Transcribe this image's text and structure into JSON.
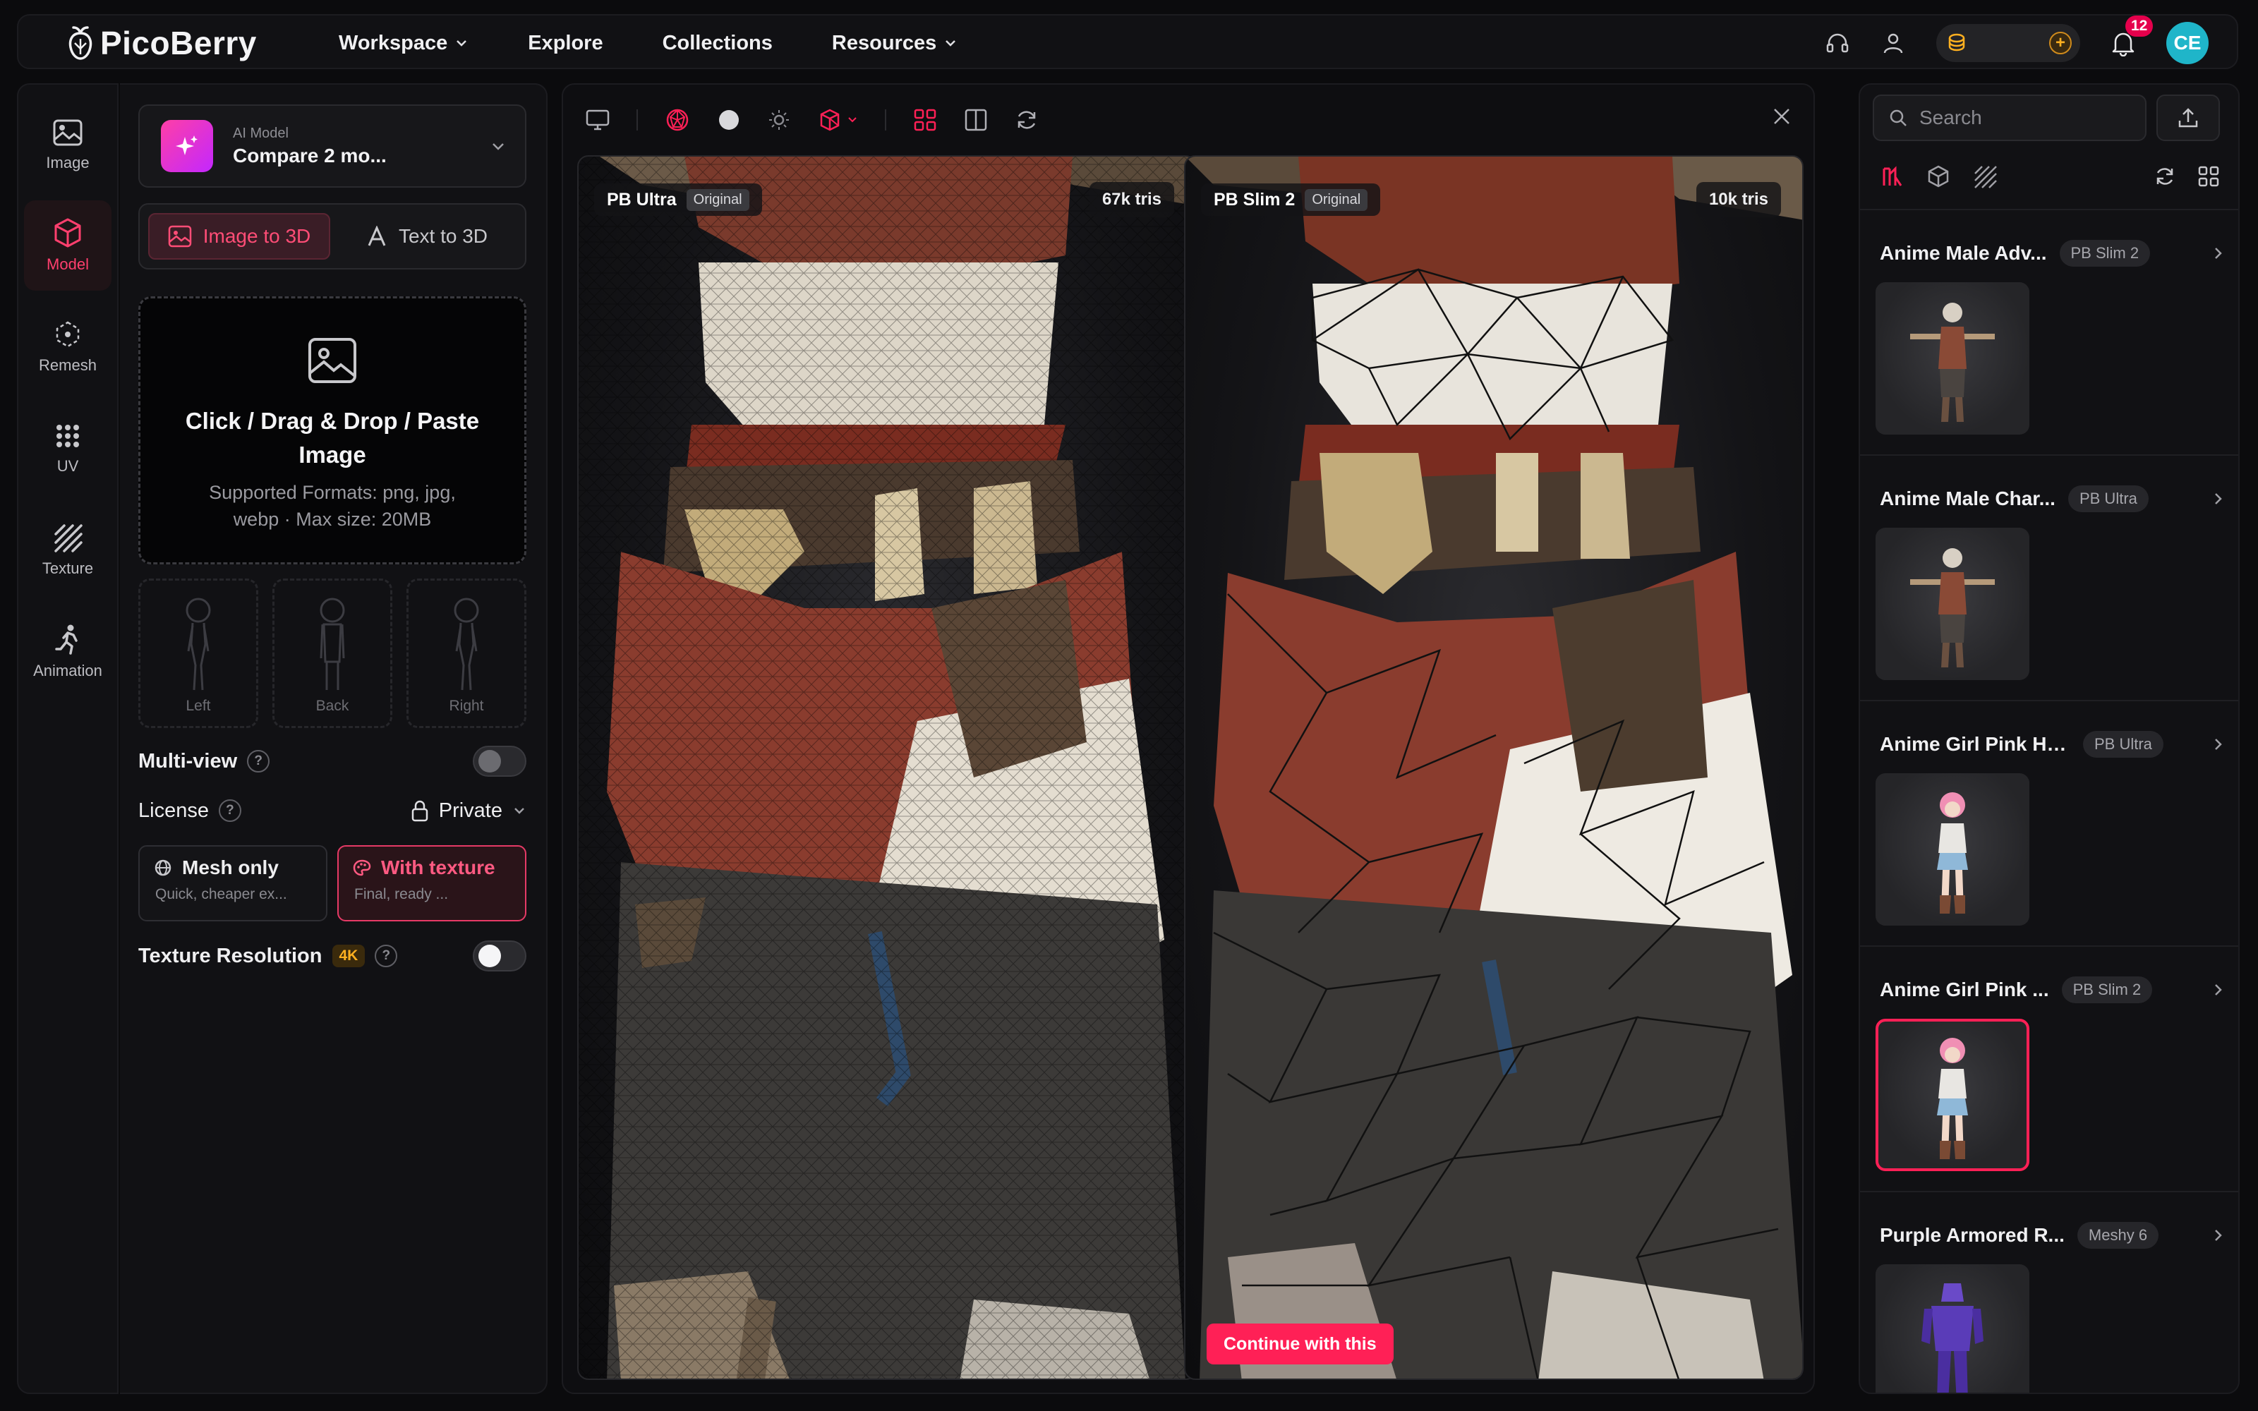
{
  "app": {
    "brand": "PicoBerry"
  },
  "nav": {
    "workspace": "Workspace",
    "explore": "Explore",
    "collections": "Collections",
    "resources": "Resources"
  },
  "top": {
    "notifications": "12",
    "avatar_initials": "CE"
  },
  "rail": [
    {
      "label": "Image"
    },
    {
      "label": "Model"
    },
    {
      "label": "Remesh"
    },
    {
      "label": "UV"
    },
    {
      "label": "Texture"
    },
    {
      "label": "Animation"
    }
  ],
  "panel": {
    "model_kicker": "AI Model",
    "model_value": "Compare 2 mo...",
    "mode_image": "Image to 3D",
    "mode_text": "Text to 3D",
    "drop_title": "Click / Drag & Drop / Paste Image",
    "drop_hint": "Supported Formats: png, jpg, webp · Max size: 20MB",
    "views": [
      "Left",
      "Back",
      "Right"
    ],
    "multiview": "Multi-view",
    "license_label": "License",
    "license_value": "Private",
    "mesh_only_title": "Mesh only",
    "mesh_only_sub": "Quick, cheaper ex...",
    "with_texture_title": "With texture",
    "with_texture_sub": "Final, ready ...",
    "tex_res_label": "Texture Resolution",
    "tex_res_badge": "4K"
  },
  "viewer": {
    "left": {
      "name": "PB Ultra",
      "tag": "Original",
      "tris": "67k tris"
    },
    "right": {
      "name": "PB Slim 2",
      "tag": "Original",
      "tris": "10k tris"
    },
    "continue": "Continue with this"
  },
  "library": {
    "search_placeholder": "Search",
    "items": [
      {
        "name": "Anime Male Adv...",
        "tag": "PB Slim 2"
      },
      {
        "name": "Anime Male Char...",
        "tag": "PB Ultra"
      },
      {
        "name": "Anime Girl Pink Hair",
        "tag": "PB Ultra"
      },
      {
        "name": "Anime Girl Pink ...",
        "tag": "PB Slim 2"
      },
      {
        "name": "Purple Armored R...",
        "tag": "Meshy 6"
      }
    ]
  },
  "colors": {
    "accent": "#ff2056",
    "accent_soft": "#ff4d76",
    "bg": "#0b0b0d",
    "panel": "#111114",
    "gold": "#ffb020",
    "avatar": "#1fb5c9"
  }
}
